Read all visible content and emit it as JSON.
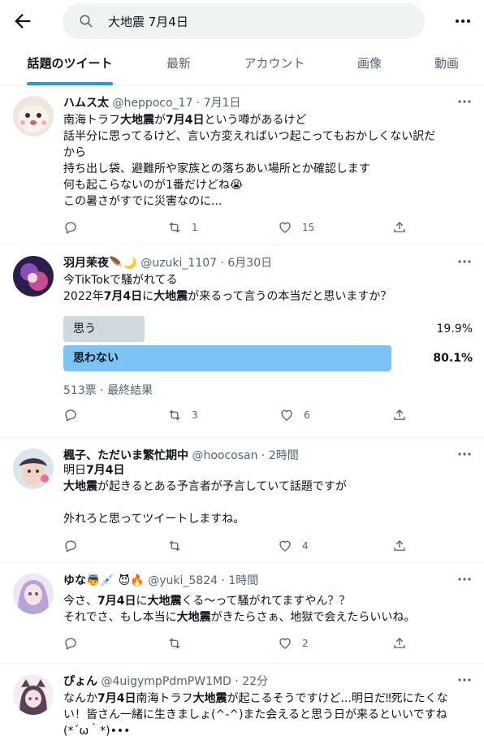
{
  "search": {
    "query": "大地震 7月4日"
  },
  "tabs": [
    {
      "label": "話題のツイート",
      "active": true
    },
    {
      "label": "最新"
    },
    {
      "label": "アカウント"
    },
    {
      "label": "画像"
    },
    {
      "label": "動画"
    }
  ],
  "tweets": [
    {
      "name": "ハムス太",
      "meta": "@heppoco_17 · 7月1日",
      "lines": [
        [
          "南海トラフ",
          "<b>大地震</b>",
          "が",
          "<b>7月4日</b>",
          "という噂があるけど"
        ],
        [
          "話半分に思ってるけど、言い方変えればいつ起こってもおかしくない訳だ"
        ],
        [
          "から"
        ],
        [
          "持ち出し袋、避難所や家族との落ちあい場所とか確認します"
        ],
        [
          "何も起こらないのが1番だけどね😭"
        ],
        [
          "この暑さがすでに災害なのに..."
        ]
      ],
      "replies": "",
      "retweets": "1",
      "likes": "15"
    },
    {
      "name": "羽月茉夜🪶🌙",
      "meta": "@uzuki_1107 · 6月30日",
      "lines": [
        [
          "今TikTokで騒がれてる"
        ],
        [
          "2022年",
          "<b>7月4日</b>",
          "に",
          "<b>大地震</b>",
          "が来るって言うの本当だと思いますか？"
        ]
      ],
      "poll": {
        "options": [
          {
            "label": "思う",
            "percent": "19.9%",
            "value": 19.9,
            "winner": false
          },
          {
            "label": "思わない",
            "percent": "80.1%",
            "value": 80.1,
            "winner": true
          }
        ],
        "meta": "513票 · 最終結果"
      },
      "replies": "",
      "retweets": "3",
      "likes": "6"
    },
    {
      "name": "楓子、ただいま繁忙期中",
      "meta": "@hoocosan · 2時間",
      "lines": [
        [
          "明日",
          "<b>7月4日</b>"
        ],
        [
          "<b>大地震</b>",
          "が起きるとある予言者が予言していて話題ですが"
        ],
        [
          ""
        ],
        [
          "外れろと思ってツイートしますね。"
        ]
      ],
      "replies": "",
      "retweets": "",
      "likes": "4"
    },
    {
      "name": "ゆな👼💉 😈🔥",
      "meta": "@yuki_5824 · 1時間",
      "lines": [
        [
          "今さ、",
          "<b>7月4日</b>",
          "に",
          "<b>大地震</b>",
          "くる〜って騒がれてますやん？？"
        ],
        [
          "それでさ、もし本当に",
          "<b>大地震</b>",
          "がきたらさぁ、地獄で会えたらいいね。"
        ]
      ],
      "replies": "",
      "retweets": "",
      "likes": "2"
    },
    {
      "name": "ぴょん",
      "meta": "@4uigympPdmPW1MD · 22分",
      "lines": [
        [
          "なんか",
          "<b>7月4日</b>",
          "南海トラフ",
          "<b>大地震</b>",
          "が起こるそうですけど...明日だ‼死にたくな"
        ],
        [
          "い！皆さん一緒に生きましょ(^-^)また会えると思う日が来るといいですね"
        ],
        [
          "(*´ω｀*)•••"
        ]
      ]
    }
  ],
  "colors": {
    "accent": "#1d9bf0",
    "muted": "#536471",
    "poll_loser": "#cfd9de",
    "poll_winner": "#7bc4f5"
  },
  "icons": [
    "back-arrow-icon",
    "search-icon",
    "more-icon",
    "reply-icon",
    "retweet-icon",
    "like-icon",
    "share-icon"
  ]
}
